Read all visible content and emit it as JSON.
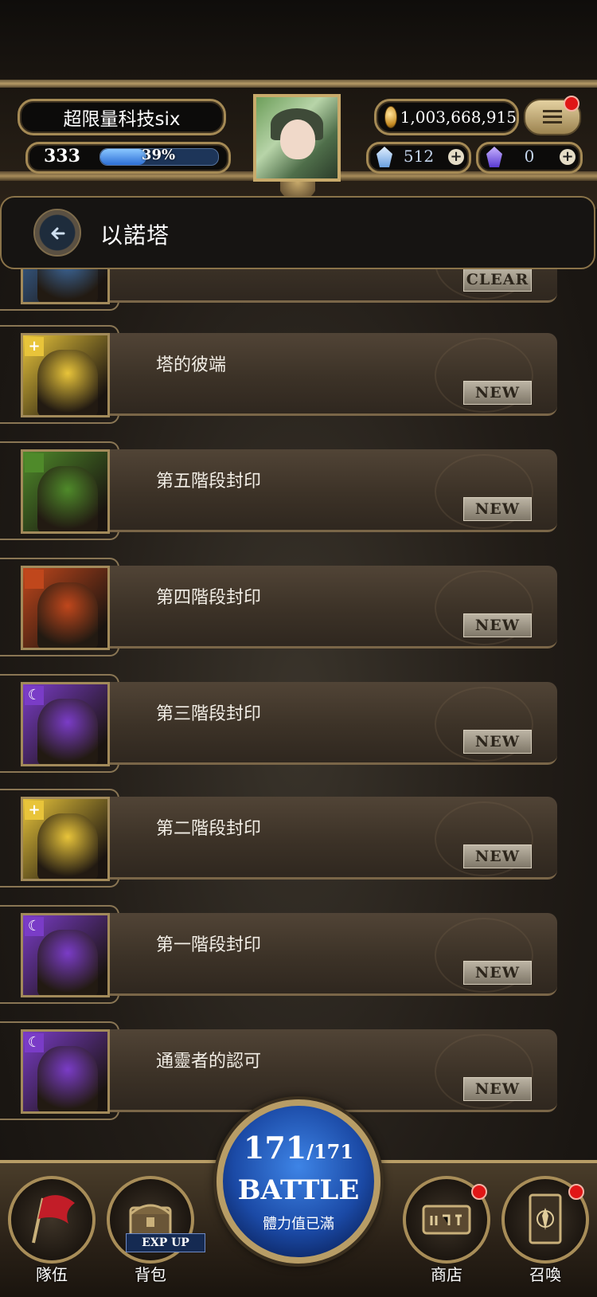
{
  "header": {
    "player_name": "超限量科技six",
    "level": "333",
    "exp_percent_label": "39%",
    "exp_fraction": 0.39,
    "coins": "1,003,668,915",
    "diamonds": "512",
    "soul_gems": "0",
    "plus": "+"
  },
  "location": {
    "title": "以諾塔"
  },
  "stages": [
    {
      "title": "",
      "status": "CLEAR",
      "attribute": "water",
      "badge": ""
    },
    {
      "title": "塔的彼端",
      "status": "NEW",
      "attribute": "light",
      "badge": "+"
    },
    {
      "title": "第五階段封印",
      "status": "NEW",
      "attribute": "wood",
      "badge": ""
    },
    {
      "title": "第四階段封印",
      "status": "NEW",
      "attribute": "fire",
      "badge": ""
    },
    {
      "title": "第三階段封印",
      "status": "NEW",
      "attribute": "dark",
      "badge": "☾"
    },
    {
      "title": "第二階段封印",
      "status": "NEW",
      "attribute": "light",
      "badge": "+"
    },
    {
      "title": "第一階段封印",
      "status": "NEW",
      "attribute": "dark",
      "badge": "☾"
    },
    {
      "title": "通靈者的認可",
      "status": "NEW",
      "attribute": "dark",
      "badge": "☾"
    }
  ],
  "colors": {
    "water": "#3f6fa8",
    "light": "#e8c43a",
    "wood": "#4f8a2a",
    "fire": "#c0471c",
    "dark": "#7a3cc7"
  },
  "nav": {
    "team": "隊伍",
    "backpack": "背包",
    "exp_up": "EXP UP",
    "shop": "商店",
    "summon": "召喚",
    "stamina_current": "171",
    "stamina_max": "/171",
    "battle": "BATTLE",
    "battle_sub": "體力值已滿"
  }
}
